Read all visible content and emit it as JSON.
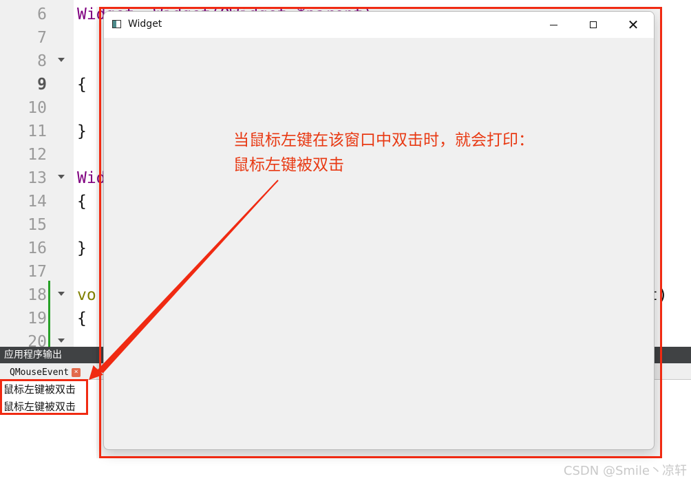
{
  "editor": {
    "lines": [
      {
        "no": "6",
        "code": "Widget::Widget(QWidget *parent)"
      },
      {
        "no": "7",
        "code": ""
      },
      {
        "no": "8",
        "code": ""
      },
      {
        "no": "9",
        "code": "{"
      },
      {
        "no": "10",
        "code": ""
      },
      {
        "no": "11",
        "code": "}"
      },
      {
        "no": "12",
        "code": ""
      },
      {
        "no": "13",
        "code": "Wid"
      },
      {
        "no": "14",
        "code": "{"
      },
      {
        "no": "15",
        "code": ""
      },
      {
        "no": "16",
        "code": "}"
      },
      {
        "no": "17",
        "code": ""
      },
      {
        "no": "18",
        "code": "vo"
      },
      {
        "no": "19",
        "code": "{"
      },
      {
        "no": "20",
        "code": ""
      }
    ],
    "line18_tail": "t)"
  },
  "output": {
    "header": "应用程序输出",
    "tab_label": "QMouseEvent",
    "tab_close": "×",
    "lines": [
      "鼠标左键被双击",
      "鼠标左键被双击"
    ]
  },
  "window": {
    "title": "Widget",
    "annotation_line1": "当鼠标左键在该窗口中双击时，就会打印：",
    "annotation_line2": "鼠标左键被双击"
  },
  "icons": [
    "app-window-icon",
    "minimize-icon",
    "maximize-icon",
    "close-icon",
    "fold-arrow-icon",
    "tab-close-icon"
  ],
  "colors": {
    "annotation_red": "#f02a12",
    "keyword_purple": "#800080",
    "output_header": "#404244"
  },
  "watermark": "CSDN @Smile丶凉轩"
}
